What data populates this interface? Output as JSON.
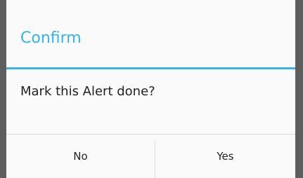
{
  "dialog": {
    "title": "Confirm",
    "message": "Mark this Alert done?",
    "buttons": {
      "negative_label": "No",
      "positive_label": "Yes"
    }
  },
  "colors": {
    "accent": "#33b5e5",
    "dialog_background": "#fafafa",
    "overlay": "#5e5e5e"
  }
}
